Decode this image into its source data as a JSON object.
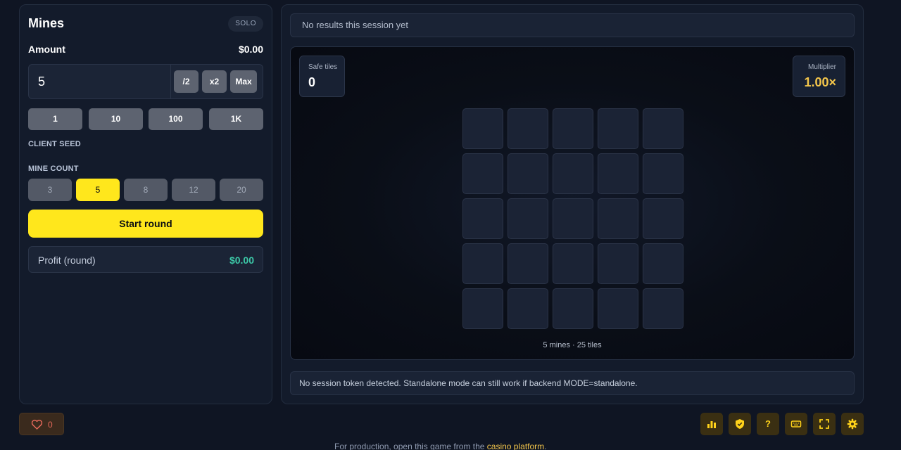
{
  "left_panel": {
    "title": "Mines",
    "mode_badge": "SOLO",
    "amount_label": "Amount",
    "amount_display": "$0.00",
    "amount_input_value": "5",
    "half_label": "/2",
    "double_label": "x2",
    "max_label": "Max",
    "quick_amounts": [
      "1",
      "10",
      "100",
      "1K"
    ],
    "client_seed_label": "CLIENT SEED",
    "mine_count_label": "MINE COUNT",
    "mine_counts": [
      "3",
      "5",
      "8",
      "12",
      "20"
    ],
    "mine_count_selected": "5",
    "start_label": "Start round",
    "profit_label": "Profit (round)",
    "profit_value": "$0.00"
  },
  "game_panel": {
    "results_text": "No results this session yet",
    "safe_tiles_label": "Safe tiles",
    "safe_tiles_value": "0",
    "multiplier_label": "Multiplier",
    "multiplier_value": "1.00×",
    "grid_rows": 5,
    "grid_cols": 5,
    "caption": "5 mines · 25 tiles",
    "notice": "No session token detected. Standalone mode can still work if backend MODE=standalone."
  },
  "bottom_bar": {
    "like_count": "0",
    "tools": [
      {
        "icon": "bar-chart-icon"
      },
      {
        "icon": "shield-icon"
      },
      {
        "icon": "help-icon",
        "glyph": "?"
      },
      {
        "icon": "keyboard-icon"
      },
      {
        "icon": "fullscreen-icon"
      },
      {
        "icon": "settings-gear-icon"
      }
    ],
    "footer_prefix": "For production, open this game from the ",
    "footer_link": "casino platform",
    "footer_suffix": "."
  },
  "colors": {
    "accent_yellow": "#ffe71c",
    "profit_green": "#3cc9a8",
    "multiplier_gold": "#f4c64b",
    "like_red": "#e3685a"
  }
}
